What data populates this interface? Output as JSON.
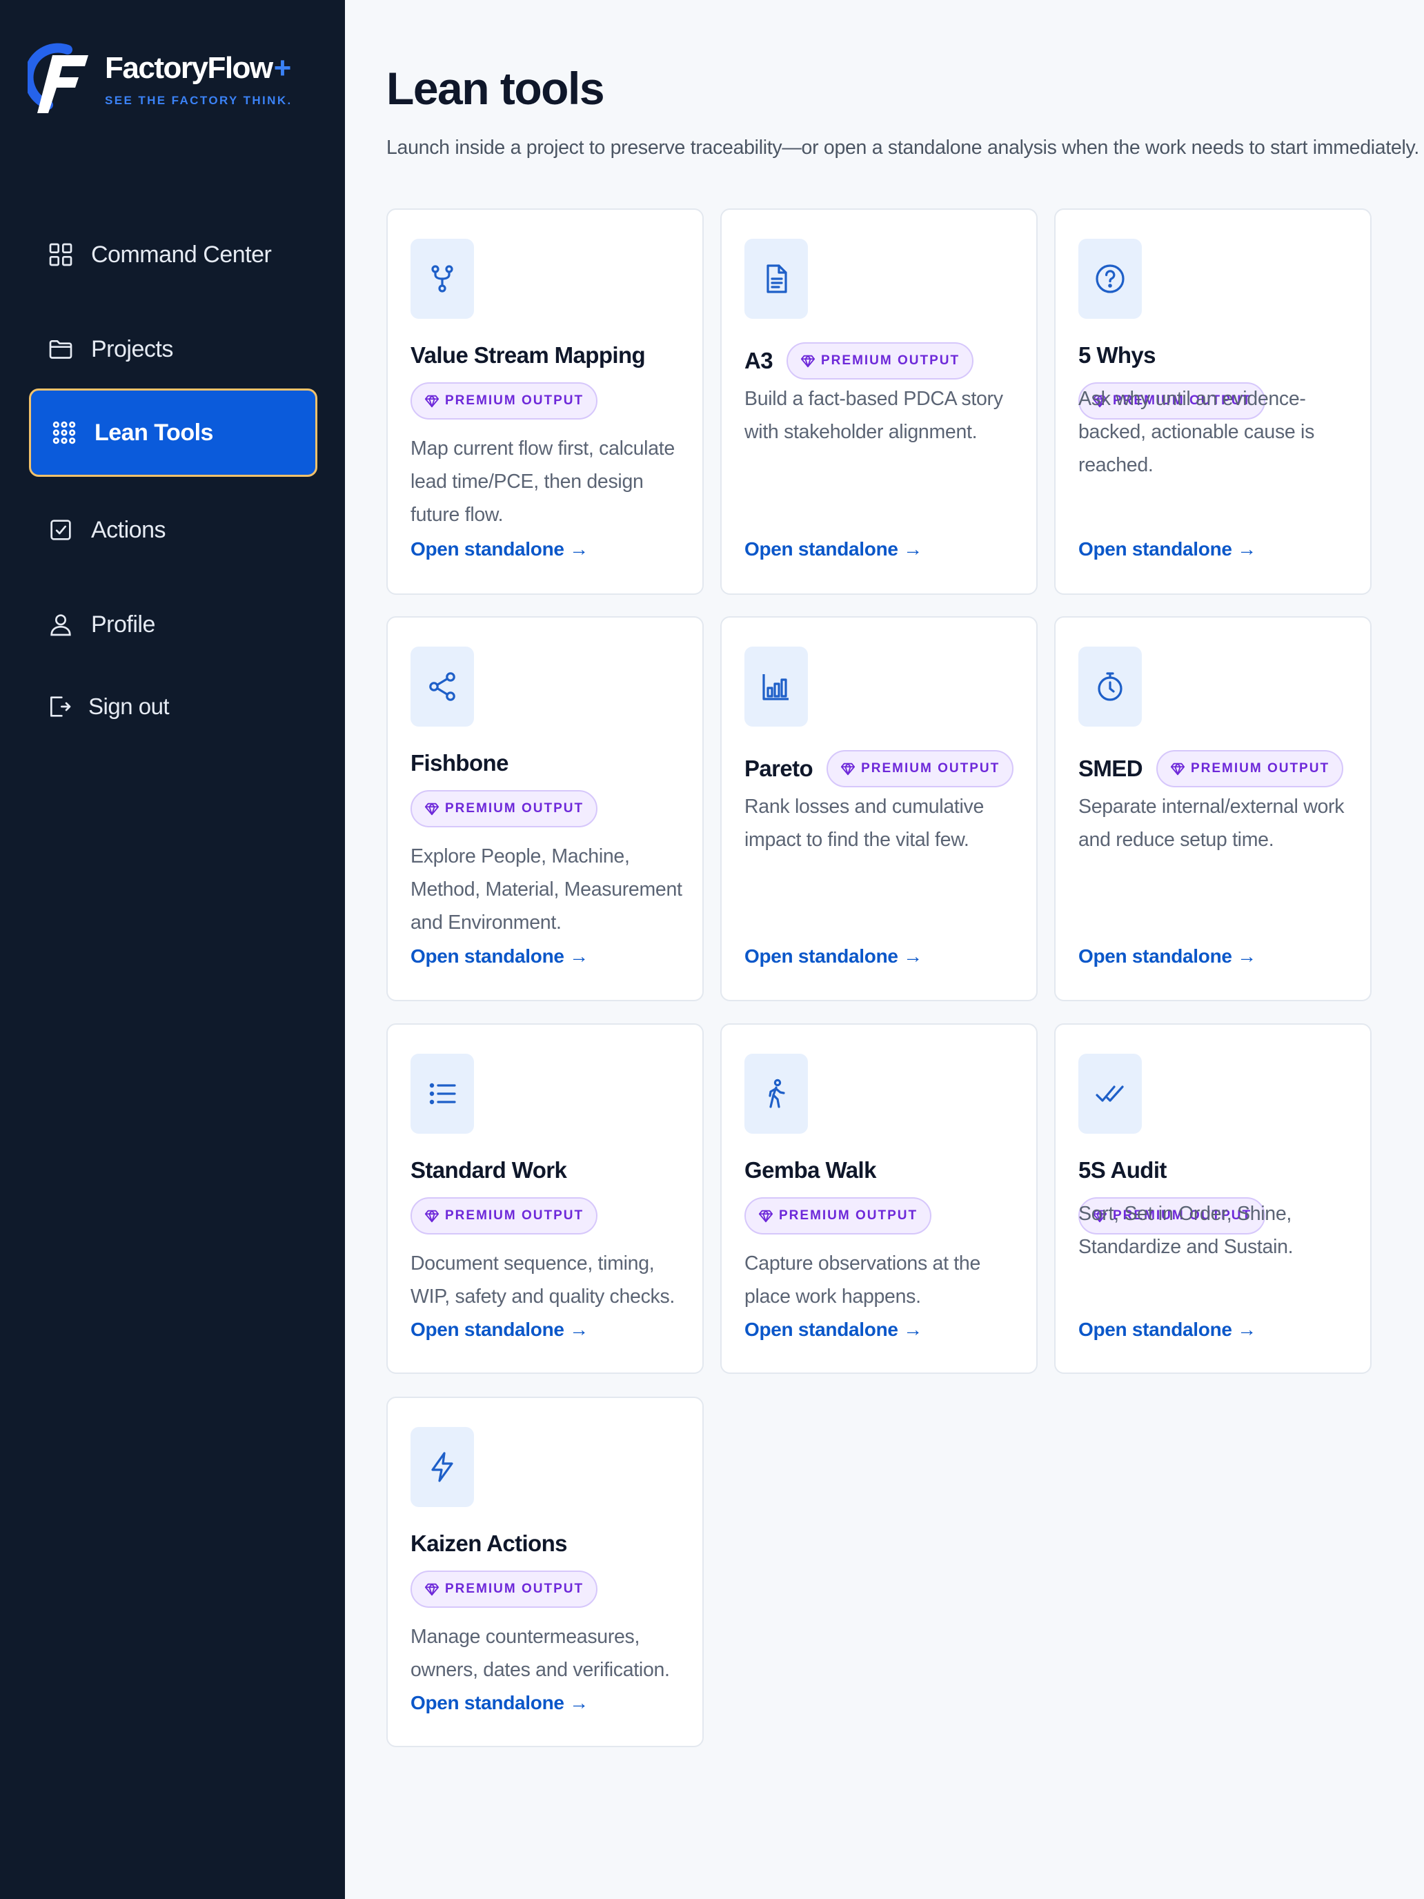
{
  "brand": {
    "name": "FactoryFlow",
    "plus": "+",
    "tagline": "SEE THE FACTORY THINK.",
    "colors": {
      "primary": "#3b82f6",
      "sidebar_bg": "#0f1a2b"
    }
  },
  "sidebar": {
    "items": [
      {
        "label": "Command Center",
        "icon": "grid-icon",
        "active": false
      },
      {
        "label": "Projects",
        "icon": "folder-icon",
        "active": false
      },
      {
        "label": "Lean Tools",
        "icon": "dots-grid-icon",
        "active": true
      },
      {
        "label": "Actions",
        "icon": "checkbox-icon",
        "active": false
      },
      {
        "label": "Profile",
        "icon": "user-icon",
        "active": false
      },
      {
        "label": "Sign out",
        "icon": "sign-out-icon",
        "active": false
      }
    ]
  },
  "header": {
    "title": "Lean tools",
    "subtitle": "Launch inside a project to preserve traceability—or open a standalone analysis when the work needs to start immediately."
  },
  "badge_label": "PREMIUM OUTPUT",
  "tools": [
    {
      "title": "Value Stream Mapping",
      "icon": "branch-icon",
      "premium": true,
      "description": "Map current flow first, calculate lead time/PCE, then design future flow.",
      "link": "Open standalone →"
    },
    {
      "title": "A3",
      "icon": "document-icon",
      "premium": true,
      "description": "Build a fact-based PDCA story with stakeholder alignment.",
      "link": "Open standalone →"
    },
    {
      "title": "5 Whys",
      "icon": "question-icon",
      "premium": true,
      "description": "Ask why until an evidence-backed, actionable cause is reached.",
      "link": "Open standalone →"
    },
    {
      "title": "Fishbone",
      "icon": "share-icon",
      "premium": true,
      "description": "Explore People, Machine, Method, Material, Measurement and Environment.",
      "link": "Open standalone →"
    },
    {
      "title": "Pareto",
      "icon": "bar-chart-icon",
      "premium": true,
      "description": "Rank losses and cumulative impact to find the vital few.",
      "link": "Open standalone →"
    },
    {
      "title": "SMED",
      "icon": "stopwatch-icon",
      "premium": true,
      "description": "Separate internal/external work and reduce setup time.",
      "link": "Open standalone →"
    },
    {
      "title": "Standard Work",
      "icon": "list-icon",
      "premium": true,
      "description": "Document sequence, timing, WIP, safety and quality checks.",
      "link": "Open standalone →"
    },
    {
      "title": "Gemba Walk",
      "icon": "walking-icon",
      "premium": true,
      "description": "Capture observations at the place work happens.",
      "link": "Open standalone →"
    },
    {
      "title": "5S Audit",
      "icon": "double-check-icon",
      "premium": true,
      "description": "Sort, Set in Order, Shine, Standardize and Sustain.",
      "link": "Open standalone →"
    },
    {
      "title": "Kaizen Actions",
      "icon": "lightning-icon",
      "premium": true,
      "description": "Manage countermeasures, owners, dates and verification.",
      "link": "Open standalone →"
    }
  ]
}
